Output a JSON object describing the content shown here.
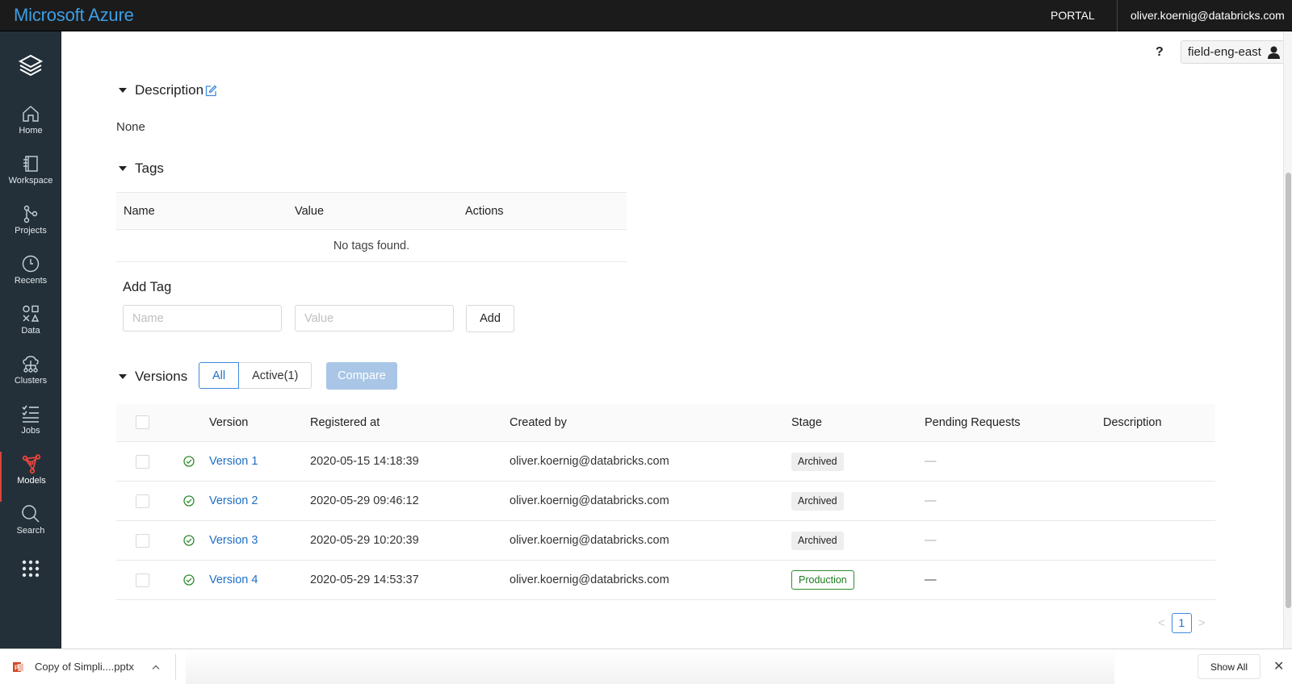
{
  "topbar": {
    "brand": "Microsoft Azure",
    "portal_label": "PORTAL",
    "user_email": "oliver.koernig@databricks.com"
  },
  "sidebar": {
    "items": [
      {
        "label": "Home",
        "icon": "home-icon"
      },
      {
        "label": "Workspace",
        "icon": "workspace-icon"
      },
      {
        "label": "Projects",
        "icon": "projects-icon"
      },
      {
        "label": "Recents",
        "icon": "clock-icon"
      },
      {
        "label": "Data",
        "icon": "data-shapes-icon"
      },
      {
        "label": "Clusters",
        "icon": "cloud-cluster-icon"
      },
      {
        "label": "Jobs",
        "icon": "checklist-icon"
      },
      {
        "label": "Models",
        "icon": "models-icon",
        "active": true
      },
      {
        "label": "Search",
        "icon": "search-icon"
      }
    ],
    "apps_icon": "grid-dots-icon"
  },
  "header": {
    "help_label": "?",
    "workspace_label": "field-eng-east"
  },
  "description": {
    "title": "Description",
    "value": "None"
  },
  "tags": {
    "title": "Tags",
    "columns": [
      "Name",
      "Value",
      "Actions"
    ],
    "empty_text": "No tags found.",
    "add_title": "Add Tag",
    "name_placeholder": "Name",
    "value_placeholder": "Value",
    "add_button": "Add"
  },
  "versions": {
    "title": "Versions",
    "filters": [
      {
        "label": "All",
        "selected": true
      },
      {
        "label": "Active(1)",
        "selected": false
      }
    ],
    "compare_button": "Compare",
    "columns": [
      "Version",
      "Registered at",
      "Created by",
      "Stage",
      "Pending Requests",
      "Description"
    ],
    "rows": [
      {
        "version": "Version 1",
        "registered_at": "2020-05-15 14:18:39",
        "created_by": "oliver.koernig@databricks.com",
        "stage": "Archived",
        "pending": "—",
        "description": ""
      },
      {
        "version": "Version 2",
        "registered_at": "2020-05-29 09:46:12",
        "created_by": "oliver.koernig@databricks.com",
        "stage": "Archived",
        "pending": "—",
        "description": ""
      },
      {
        "version": "Version 3",
        "registered_at": "2020-05-29 10:20:39",
        "created_by": "oliver.koernig@databricks.com",
        "stage": "Archived",
        "pending": "—",
        "description": ""
      },
      {
        "version": "Version 4",
        "registered_at": "2020-05-29 14:53:37",
        "created_by": "oliver.koernig@databricks.com",
        "stage": "Production",
        "pending": "—",
        "description": ""
      }
    ]
  },
  "pagination": {
    "prev": "<",
    "current": "1",
    "next": ">"
  },
  "download_bar": {
    "file_name": "Copy of Simpli....pptx",
    "show_all": "Show All",
    "close": "✕"
  },
  "colors": {
    "brand": "#3d9ee4",
    "sidebar_bg": "#23303a",
    "link": "#1f6fc5",
    "active_model": "#e8453c",
    "production": "#1e7a1e"
  }
}
